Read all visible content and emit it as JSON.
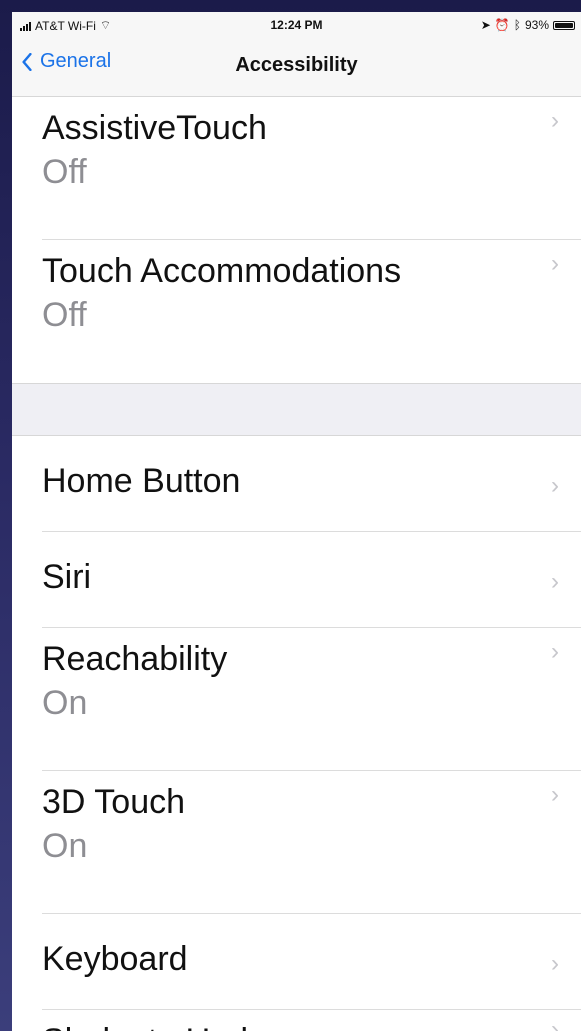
{
  "status_bar": {
    "carrier": "AT&T Wi-Fi",
    "time": "12:24 PM",
    "battery": "93%"
  },
  "nav": {
    "back_label": "General",
    "title": "Accessibility"
  },
  "settings": {
    "group1": [
      {
        "title": "AssistiveTouch",
        "value": "Off"
      },
      {
        "title": "Touch Accommodations",
        "value": "Off"
      }
    ],
    "group2": [
      {
        "title": "Home Button",
        "value": ""
      },
      {
        "title": "Siri",
        "value": ""
      },
      {
        "title": "Reachability",
        "value": "On"
      },
      {
        "title": "3D Touch",
        "value": "On"
      },
      {
        "title": "Keyboard",
        "value": ""
      },
      {
        "title": "Shake to Undo",
        "value": ""
      }
    ]
  },
  "icons": {
    "back": "chevron-left-icon",
    "disclosure": "chevron-right-icon"
  }
}
